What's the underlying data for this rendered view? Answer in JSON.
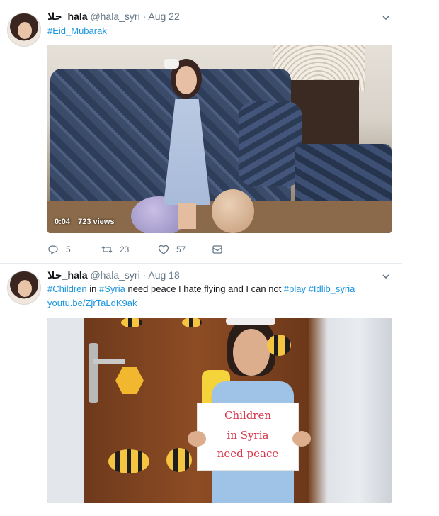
{
  "tweets": [
    {
      "display_name": "حلا_hala",
      "handle": "@hala_syri",
      "separator": "·",
      "date": "Aug 22",
      "hashtag": "#Eid_Mubarak",
      "video": {
        "duration": "0:04",
        "views": "723 views"
      },
      "actions": {
        "replies": "5",
        "retweets": "23",
        "likes": "57"
      }
    },
    {
      "display_name": "حلا_hala",
      "handle": "@hala_syri",
      "separator": "·",
      "date": "Aug 18",
      "text": {
        "tag1": "#Children",
        "w1": " in ",
        "tag2": "#Syria",
        "w2": " need peace I hate flying and I can not ",
        "tag3": "#play",
        "w3": " ",
        "tag4": "#Idlib_syria",
        "link": "youtu.be/ZjrTaLdK9ak"
      },
      "sign_lines": [
        "Children",
        "in Syria",
        "need peace"
      ]
    }
  ],
  "colors": {
    "link": "#1b95e0",
    "muted": "#657786",
    "divider": "#e6ecf0"
  }
}
